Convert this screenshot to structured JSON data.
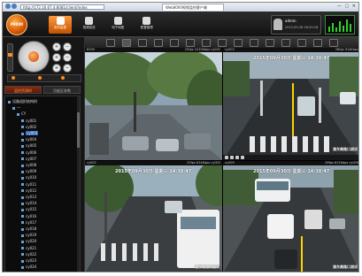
{
  "browser": {
    "address": "http://172.16.67.4:8081/client/index",
    "tabs": [
      "Web8000视频监控客户端"
    ],
    "controls": "— ▢ ✕"
  },
  "app": {
    "logo_text": "P9000",
    "nav": [
      {
        "label": "实时监视",
        "icon": "monitor-icon",
        "active": true
      },
      {
        "label": "视频回放",
        "icon": "playback-icon",
        "active": false
      },
      {
        "label": "电子地图",
        "icon": "map-icon",
        "active": false
      },
      {
        "label": "配置管理",
        "icon": "config-icon",
        "active": false
      }
    ],
    "user": {
      "name": "admin",
      "time": "2013-05-28 16:20:18"
    }
  },
  "left_panel": {
    "tabs": [
      "监控资源树",
      "功能区参数"
    ],
    "tree": [
      {
        "label": "设备组织结构树",
        "level": 0
      },
      {
        "label": "一",
        "level": 1
      },
      {
        "label": "CY",
        "level": 2
      },
      {
        "label": "cy001",
        "level": 3
      },
      {
        "label": "cy002",
        "level": 3
      },
      {
        "label": "cy003",
        "level": 3,
        "selected": true
      },
      {
        "label": "cy004",
        "level": 3
      },
      {
        "label": "cy005",
        "level": 3
      },
      {
        "label": "cy006",
        "level": 3
      },
      {
        "label": "cy007",
        "level": 3
      },
      {
        "label": "cy008",
        "level": 3
      },
      {
        "label": "cy009",
        "level": 3
      },
      {
        "label": "cy010",
        "level": 3
      },
      {
        "label": "cy011",
        "level": 3
      },
      {
        "label": "cy012",
        "level": 3
      },
      {
        "label": "cy013",
        "level": 3
      },
      {
        "label": "cy014",
        "level": 3
      },
      {
        "label": "cy015",
        "level": 3
      },
      {
        "label": "cy016",
        "level": 3
      },
      {
        "label": "cy017",
        "level": 3
      },
      {
        "label": "cy018",
        "level": 3
      },
      {
        "label": "cy019",
        "level": 3
      },
      {
        "label": "cy020",
        "level": 3
      },
      {
        "label": "cy021",
        "level": 3
      },
      {
        "label": "cy022",
        "level": 3
      },
      {
        "label": "cy023",
        "level": 3
      },
      {
        "label": "cy024",
        "level": 3
      }
    ]
  },
  "videos": [
    {
      "name": "8290",
      "center": "",
      "right": "25fps 1015Kbps cy001",
      "stamp": "",
      "place": ""
    },
    {
      "name": "cy003",
      "center": "",
      "right": "28fps 914Kbps",
      "stamp": "2015年09月30日 星期三 14:38:47",
      "place": "渝东南路口测试"
    },
    {
      "name": "cy002",
      "center": "",
      "right": "25fps 814Kbps cy002",
      "stamp": "2015年09月30日 星期三 14:38:47",
      "place": "渝东南路口测试"
    },
    {
      "name": "cy009",
      "center": "",
      "right": "28fps 811Kbps cy009",
      "stamp": "2015年09月30日 星期三 14:38:47",
      "place": "渝东南路口测试"
    }
  ]
}
